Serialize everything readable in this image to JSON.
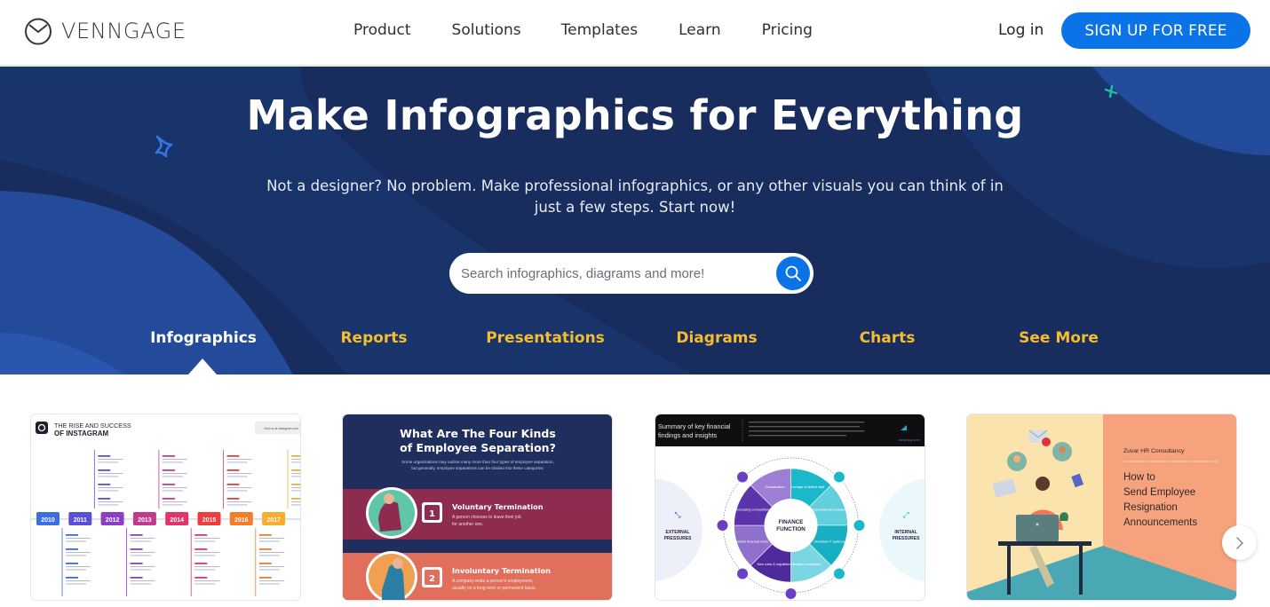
{
  "header": {
    "brand": "VENNGAGE",
    "nav": [
      "Product",
      "Solutions",
      "Templates",
      "Learn",
      "Pricing"
    ],
    "login_label": "Log in",
    "signup_label": "SIGN UP FOR FREE"
  },
  "hero": {
    "title": "Make Infographics for Everything",
    "subtitle": "Not a designer? No problem. Make professional infographics, or any other visuals you can think of in just a few steps. Start now!",
    "search_placeholder": "Search infographics, diagrams and more!",
    "search_value": ""
  },
  "tabs": [
    {
      "label": "Infographics",
      "active": true
    },
    {
      "label": "Reports",
      "active": false
    },
    {
      "label": "Presentations",
      "active": false
    },
    {
      "label": "Diagrams",
      "active": false
    },
    {
      "label": "Charts",
      "active": false
    },
    {
      "label": "See More",
      "active": false
    }
  ],
  "colors": {
    "brand_blue": "#0a73e8",
    "hero_navy": "#182c5e",
    "tab_inactive": "#f5bd2e",
    "tab_active": "#ffffff"
  },
  "cards": [
    {
      "title_line1": "THE RISE AND SUCCESS",
      "title_line2": "OF INSTAGRAM",
      "visit": "Visit us at instagram.com",
      "years": [
        "2010",
        "2011",
        "2012",
        "2013",
        "2014",
        "2015",
        "2016",
        "2017"
      ],
      "year_colors": [
        "#3b6fe0",
        "#5a4fd8",
        "#8a3fc4",
        "#c23a8e",
        "#e0346a",
        "#ef3c3c",
        "#f57c2a",
        "#f7ad2d"
      ],
      "month_labels_top": [
        "JANUARY",
        "SEPTEMBER",
        "DECEMBER",
        "MAY",
        "JUNE",
        "JULY",
        "NOVEMBER",
        "APRIL",
        "JUNE",
        "AUGUST",
        "SEPTEMBER",
        "JANUARY",
        "FEBRUARY",
        "MAY"
      ],
      "month_labels_bottom": [
        "OCTOBER",
        "APRIL",
        "AUGUST",
        "NOVEMBER",
        "DECEMBER",
        "JUNE",
        "AUGUST",
        "NOVEMBER",
        "DECEMBER",
        "FEBRUARY",
        "MARCH",
        "AUGUST",
        "DECEMBER"
      ]
    },
    {
      "title_line1": "What Are The Four Kinds",
      "title_line2": "of Employee Separation?",
      "intro_line1": "Some organizations may outline many more than four types of employee separation,",
      "intro_line2": "but generally, employee separations can be divided into these categories:",
      "items": [
        {
          "num": "1",
          "title": "Voluntary Termination",
          "line1": "A person chooses to leave their job",
          "line2": "for another one."
        },
        {
          "num": "2",
          "title": "Involuntary Termination",
          "line1": "A company ends a person's employment,",
          "line2": "usually on a long-term or permanent basis."
        }
      ]
    },
    {
      "title_line1": "Summary of key financial",
      "title_line2": "findings and insights",
      "url": "www.fpg.com",
      "center_line1": "FINANCE",
      "center_line2": "FUNCTION",
      "left_label_line1": "EXTERNAL",
      "left_label_line2": "PRESSURES",
      "right_label_line1": "INTERNAL",
      "right_label_line2": "PRESSURES",
      "segments_left": [
        "Globalization",
        "Increasing competition",
        "Global financial crisis",
        "New rules & regulations"
      ],
      "segments_right": [
        "Shortage of skilled staff",
        "Organizational complexity",
        "Outdated IT systems",
        "Budget constraints"
      ]
    },
    {
      "company": "Zuvar HR Consultancy",
      "title_lines": [
        "How to",
        "Send Employee",
        "Resignation",
        "Announcements"
      ]
    }
  ],
  "carousel": {
    "next_icon": "chevron-right-icon"
  }
}
